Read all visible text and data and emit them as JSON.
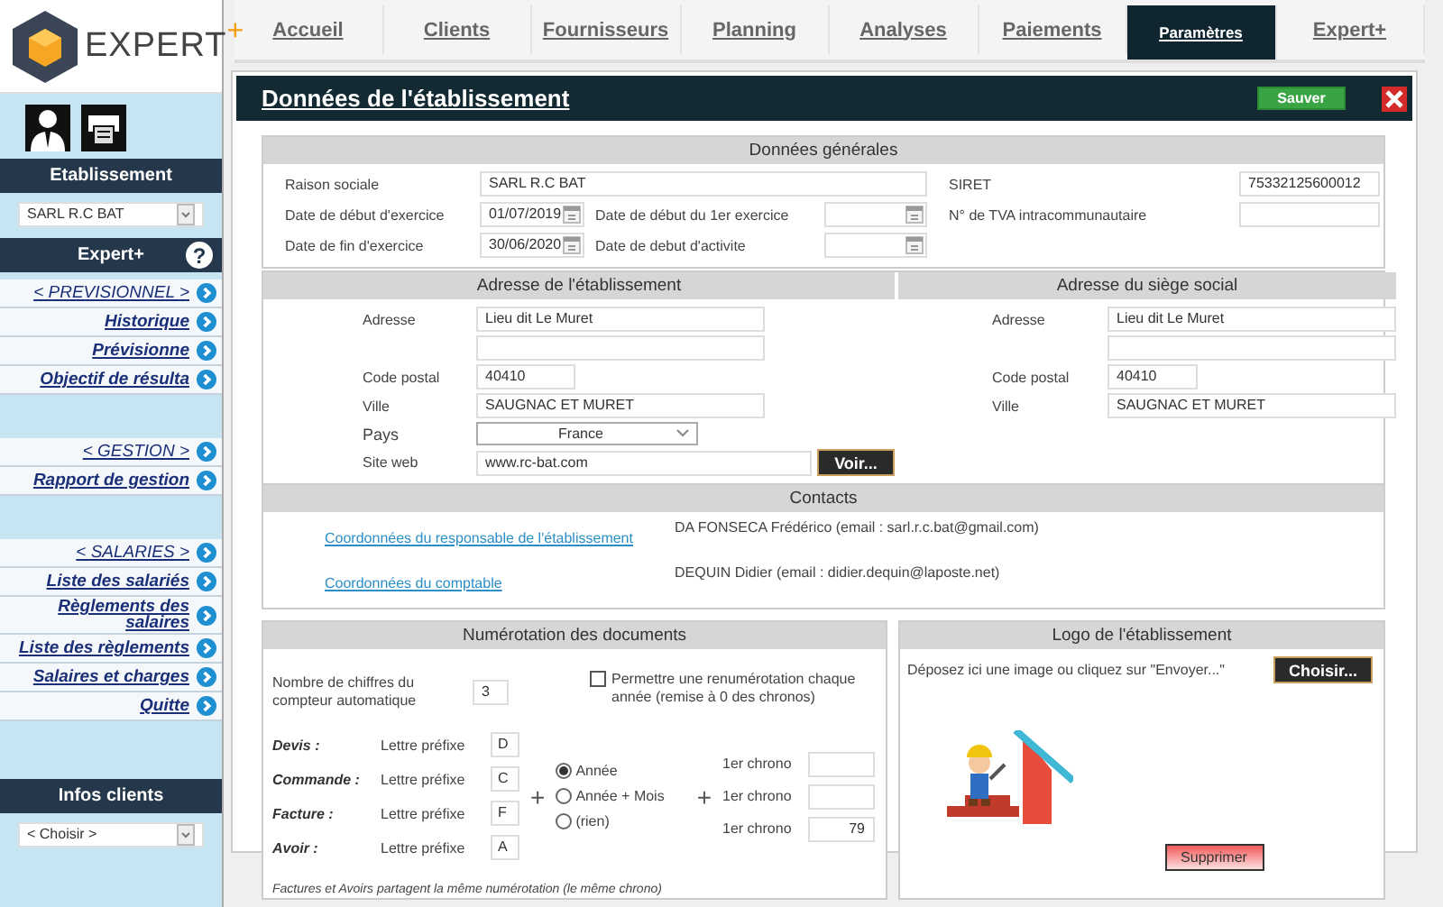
{
  "logo": {
    "brand": "EXPERT",
    "plus": "+"
  },
  "sidebar": {
    "establishment_title": "Etablissement",
    "establishment_select": "SARL R.C BAT",
    "expert_title": "Expert+",
    "help": "?",
    "menu_groups": [
      [
        {
          "label": "< PREVISIONNEL >",
          "kind": "heading"
        },
        {
          "label": "Historique",
          "kind": "link"
        },
        {
          "label": "Prévisionne",
          "kind": "link"
        },
        {
          "label": "Objectif de résulta",
          "kind": "link"
        }
      ],
      [
        {
          "label": "< GESTION >",
          "kind": "heading"
        },
        {
          "label": "Rapport de gestion",
          "kind": "link"
        }
      ],
      [
        {
          "label": "< SALARIES >",
          "kind": "heading"
        },
        {
          "label": "Liste des salariés",
          "kind": "link"
        },
        {
          "label": "Règlements des salaires",
          "kind": "link"
        },
        {
          "label": "Liste des règlements",
          "kind": "link"
        },
        {
          "label": "Salaires et charges",
          "kind": "link"
        },
        {
          "label": "Quitte",
          "kind": "link"
        }
      ]
    ],
    "clients_title": "Infos clients",
    "clients_select": "< Choisir >"
  },
  "tabs": [
    {
      "label": "Accueil",
      "selected": false
    },
    {
      "label": "Clients",
      "selected": false
    },
    {
      "label": "Fournisseurs",
      "selected": false
    },
    {
      "label": "Planning",
      "selected": false
    },
    {
      "label": "Analyses",
      "selected": false
    },
    {
      "label": "Paiements",
      "selected": false
    },
    {
      "label": "Paramètres",
      "selected": true
    },
    {
      "label": "Expert+",
      "selected": false
    }
  ],
  "page": {
    "title": "Données de l'établissement",
    "save_button": "Sauver"
  },
  "general": {
    "title": "Données générales",
    "company_name": {
      "label": "Raison sociale",
      "value": "SARL R.C BAT"
    },
    "fiscal_start": {
      "label": "Date de début d'exercice",
      "value": "01/07/2019"
    },
    "fiscal_end": {
      "label": "Date de fin d'exercice",
      "value": "30/06/2020"
    },
    "first_fiscal_start": {
      "label": "Date de début du 1er exercice"
    },
    "activity_start": {
      "label": "Date de debut d'activite"
    },
    "siret": {
      "label": "SIRET",
      "value": "75332125600012"
    },
    "vat": {
      "label": "N° de TVA intracommunautaire"
    }
  },
  "establishment_address": {
    "title": "Adresse de l'établissement",
    "address": {
      "label": "Adresse",
      "value": "Lieu dit Le Muret"
    },
    "postal_code": {
      "label": "Code postal",
      "value": "40410"
    },
    "city": {
      "label": "Ville",
      "value": "SAUGNAC ET MURET"
    },
    "country": {
      "label": "Pays",
      "value": "France"
    },
    "website": {
      "label": "Site web",
      "value": "www.rc-bat.com"
    },
    "view_button": "Voir..."
  },
  "head_office_address": {
    "title": "Adresse du siège social",
    "address": {
      "label": "Adresse",
      "value": "Lieu dit Le Muret"
    },
    "postal_code": {
      "label": "Code postal",
      "value": "40410"
    },
    "city": {
      "label": "Ville",
      "value": "SAUGNAC ET MURET"
    }
  },
  "contacts": {
    "title": "Contacts",
    "items": [
      {
        "link": "Coordonnées du responsable de l'établissement",
        "text": "DA FONSECA Frédérico (email : sarl.r.c.bat@gmail.com)"
      },
      {
        "link": "Coordonnées du comptable",
        "text": "DEQUIN Didier (email : didier.dequin@laposte.net)"
      }
    ]
  },
  "numbering": {
    "title": "Numérotation des documents",
    "counter": {
      "label": "Nombre de chiffres du compteur automatique",
      "value": "3"
    },
    "renumber": {
      "label": "Permettre une renumérotation chaque année (remise à 0 des chronos)",
      "checked": false
    },
    "documents": [
      {
        "name": "Devis :",
        "prefix_label": "Lettre préfixe",
        "prefix": "D"
      },
      {
        "name": "Commande :",
        "prefix_label": "Lettre préfixe",
        "prefix": "C"
      },
      {
        "name": "Facture :",
        "prefix_label": "Lettre préfixe",
        "prefix": "F"
      },
      {
        "name": "Avoir :",
        "prefix_label": "Lettre préfixe",
        "prefix": "A"
      }
    ],
    "plus_signs": [
      "+",
      "+"
    ],
    "date_options": [
      {
        "label": "Année",
        "selected": true
      },
      {
        "label": "Année + Mois",
        "selected": false
      },
      {
        "label": "(rien)",
        "selected": false
      }
    ],
    "chronos": [
      {
        "label": "1er chrono"
      },
      {
        "label": "1er chrono"
      },
      {
        "label": "1er chrono",
        "value": "79"
      }
    ],
    "note": "Factures et Avoirs partagent la même numérotation (le même chrono)"
  },
  "logo_section": {
    "title": "Logo de l'établissement",
    "hint": "Déposez ici une image ou cliquez sur \"Envoyer...\"",
    "choose_button": "Choisir...",
    "delete_button": "Supprimer"
  }
}
